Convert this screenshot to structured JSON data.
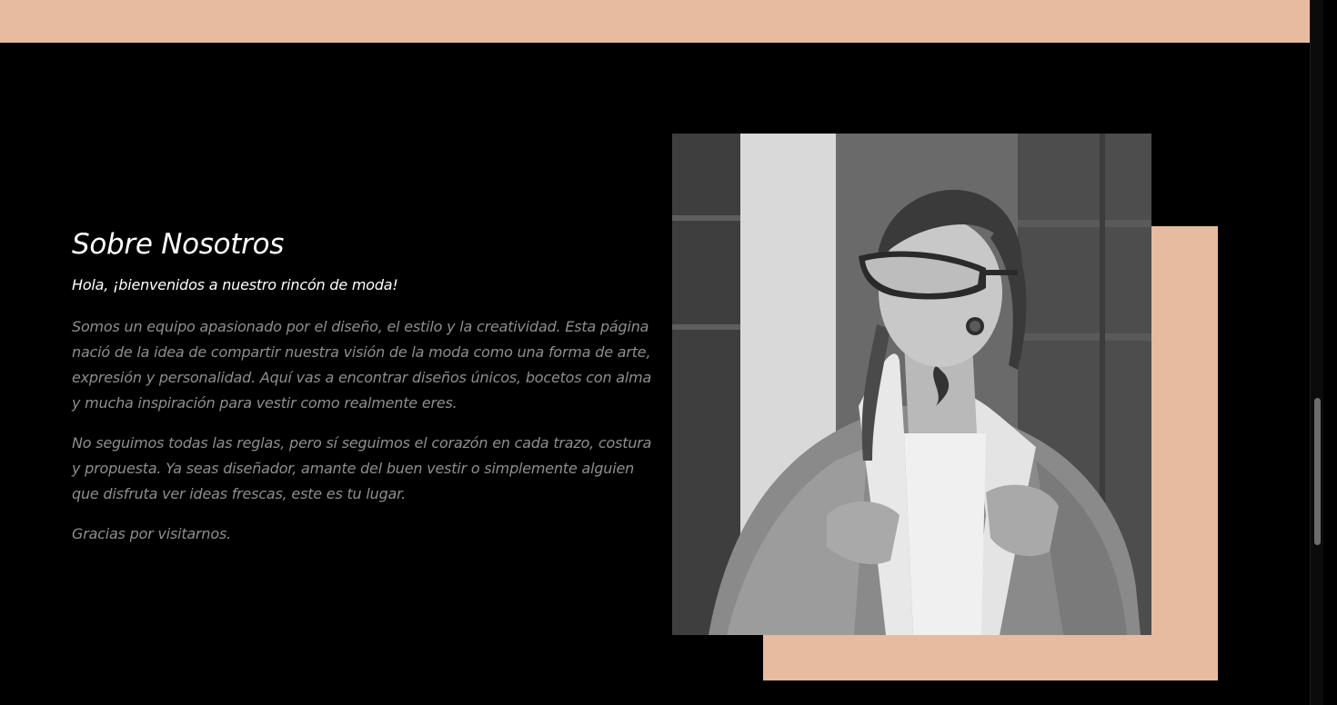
{
  "about": {
    "title": "Sobre Nosotros",
    "subtitle": "Hola, ¡bienvenidos a nuestro rincón de moda!",
    "paragraphs": [
      "Somos un equipo apasionado por el diseño, el estilo y la creatividad. Esta página nació de la idea de compartir nuestra visión de la moda como una forma de arte, expresión y personalidad. Aquí vas a encontrar diseños únicos, bocetos con alma y mucha inspiración para vestir como realmente eres.",
      "No seguimos todas las reglas, pero sí seguimos el corazón en cada trazo, costura y propuesta. Ya seas diseñador, amante del buen vestir o simplemente alguien que disfruta ver ideas frescas, este es tu lugar.",
      "Gracias por visitarnos."
    ]
  },
  "colors": {
    "accent": "#e6bba0",
    "background": "#000000",
    "title_text": "#ffffff",
    "body_text": "#8e8e8e"
  },
  "image": {
    "description_icon": "fashion-model-photo"
  }
}
